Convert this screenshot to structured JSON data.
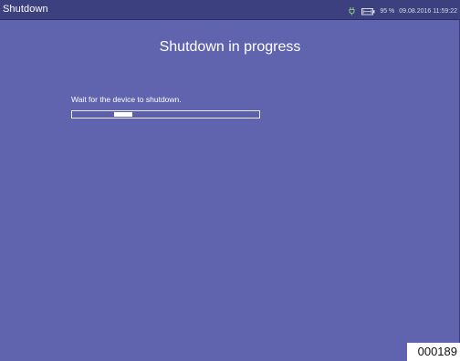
{
  "window": {
    "title": "Shutdown"
  },
  "status_bar": {
    "power_icon": "plug-icon",
    "battery_icon": "battery-icon",
    "battery_percent": "95 %",
    "datetime": "09.08.2016 11:59:22",
    "icon_color": "#86c27a"
  },
  "main": {
    "heading": "Shutdown in progress",
    "message": "Wait for the device to shutdown.",
    "progress": {
      "indicator_start_fraction": 0.22,
      "indicator_width_fraction": 0.1,
      "mode": "indeterminate"
    }
  },
  "figure_label": "000189",
  "colors": {
    "background": "#6064ae",
    "titlebar": "#3c407e",
    "text": "#ffffff"
  }
}
